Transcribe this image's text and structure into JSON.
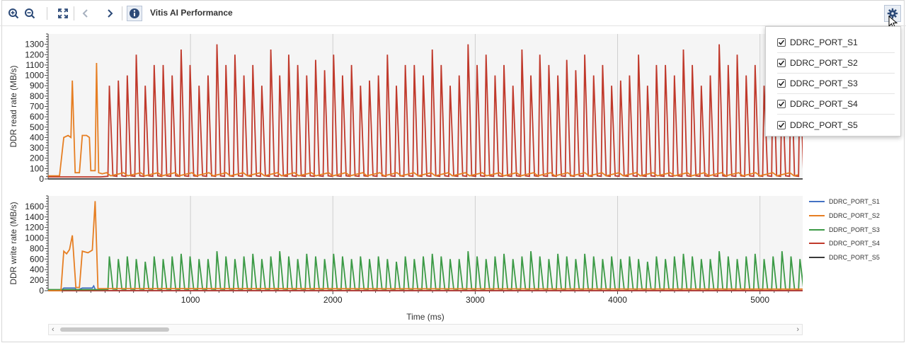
{
  "toolbar": {
    "title": "Vitis AI Performance",
    "buttons": [
      "zoom-in-icon",
      "zoom-out-icon",
      "fit-icon",
      "back-icon",
      "forward-icon",
      "info-icon"
    ]
  },
  "ports": [
    {
      "name": "DDRC_PORT_S1",
      "color": "#4472c4"
    },
    {
      "name": "DDRC_PORT_S2",
      "color": "#e67e22"
    },
    {
      "name": "DDRC_PORT_S3",
      "color": "#3c9a46"
    },
    {
      "name": "DDRC_PORT_S4",
      "color": "#c0392b"
    },
    {
      "name": "DDRC_PORT_S5",
      "color": "#3a3a3a"
    }
  ],
  "dropdown": {
    "items": [
      {
        "label": "DDRC_PORT_S1",
        "checked": true
      },
      {
        "label": "DDRC_PORT_S2",
        "checked": true
      },
      {
        "label": "DDRC_PORT_S3",
        "checked": true
      },
      {
        "label": "DDRC_PORT_S4",
        "checked": true
      },
      {
        "label": "DDRC_PORT_S5",
        "checked": true
      }
    ]
  },
  "chart_data": [
    {
      "type": "line",
      "ylabel": "DDR read rate (MB/s)",
      "xlim": [
        0,
        5300
      ],
      "ylim": [
        0,
        1400
      ],
      "yticks": [
        0,
        100,
        200,
        300,
        400,
        500,
        600,
        700,
        800,
        900,
        1000,
        1100,
        1200,
        1300
      ],
      "series": [
        {
          "name": "DDRC_PORT_S2",
          "note": "startup burst ~0-350 ms",
          "points": [
            [
              0,
              30
            ],
            [
              80,
              30
            ],
            [
              110,
              400
            ],
            [
              140,
              420
            ],
            [
              160,
              400
            ],
            [
              170,
              950
            ],
            [
              190,
              60
            ],
            [
              220,
              60
            ],
            [
              240,
              420
            ],
            [
              270,
              420
            ],
            [
              290,
              400
            ],
            [
              300,
              80
            ],
            [
              330,
              80
            ],
            [
              340,
              1120
            ],
            [
              355,
              60
            ],
            [
              5300,
              30
            ]
          ]
        },
        {
          "name": "DDRC_PORT_S4",
          "note": "periodic peaks",
          "peak_period_ms": 63,
          "peak_values": [
            900,
            950,
            1000,
            1200,
            900,
            1100,
            1100,
            1000,
            1250,
            1100,
            900,
            1000,
            1300,
            1100,
            1200,
            1000,
            1100,
            900,
            1250,
            1000,
            1200,
            1100,
            1000,
            1150,
            1050,
            1200,
            1000,
            1100
          ]
        },
        {
          "name": "DDRC_PORT_S5",
          "note": "flat near zero",
          "points": [
            [
              0,
              0
            ],
            [
              5300,
              0
            ]
          ]
        }
      ]
    },
    {
      "type": "line",
      "ylabel": "DDR write rate (MB/s)",
      "xlabel": "Time (ms)",
      "xlim": [
        0,
        5300
      ],
      "ylim": [
        0,
        1800
      ],
      "yticks": [
        0,
        200,
        400,
        600,
        800,
        1000,
        1200,
        1400,
        1600
      ],
      "xticks": [
        1000,
        2000,
        3000,
        4000,
        5000
      ],
      "series": [
        {
          "name": "DDRC_PORT_S1",
          "points": [
            [
              0,
              0
            ],
            [
              90,
              0
            ],
            [
              110,
              50
            ],
            [
              190,
              50
            ],
            [
              200,
              0
            ],
            [
              240,
              50
            ],
            [
              310,
              50
            ],
            [
              320,
              90
            ],
            [
              335,
              0
            ],
            [
              5300,
              0
            ]
          ]
        },
        {
          "name": "DDRC_PORT_S2",
          "points": [
            [
              0,
              0
            ],
            [
              90,
              0
            ],
            [
              110,
              750
            ],
            [
              130,
              700
            ],
            [
              150,
              780
            ],
            [
              170,
              1050
            ],
            [
              195,
              60
            ],
            [
              220,
              60
            ],
            [
              240,
              750
            ],
            [
              280,
              720
            ],
            [
              310,
              770
            ],
            [
              330,
              1700
            ],
            [
              350,
              40
            ],
            [
              5300,
              30
            ]
          ]
        },
        {
          "name": "DDRC_PORT_S3",
          "note": "periodic peaks",
          "peak_period_ms": 63,
          "peak_values": [
            650,
            600,
            650,
            600,
            550,
            650,
            600,
            650,
            700,
            650,
            600,
            600,
            750,
            650,
            600,
            650,
            700,
            600,
            650,
            750,
            650,
            600,
            700,
            650,
            600,
            700,
            650,
            600
          ]
        },
        {
          "name": "DDRC_PORT_S4",
          "points": [
            [
              0,
              0
            ],
            [
              5300,
              0
            ]
          ]
        },
        {
          "name": "DDRC_PORT_S5",
          "points": [
            [
              0,
              0
            ],
            [
              5300,
              0
            ]
          ]
        }
      ]
    }
  ]
}
